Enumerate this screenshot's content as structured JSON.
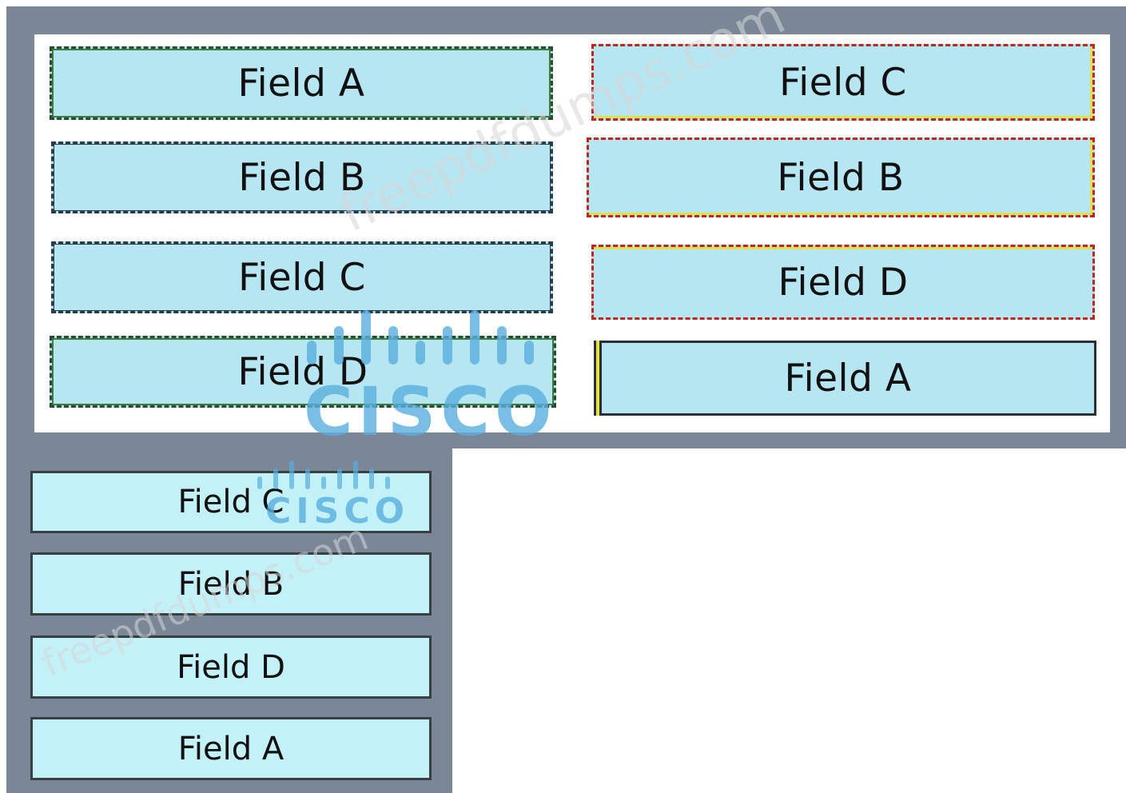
{
  "drop_targets_left": [
    {
      "label": "Field A"
    },
    {
      "label": "Field B"
    },
    {
      "label": "Field C"
    },
    {
      "label": "Field D"
    }
  ],
  "drop_targets_right": [
    {
      "label": "Field C"
    },
    {
      "label": "Field B"
    },
    {
      "label": "Field D"
    },
    {
      "label": "Field A"
    }
  ],
  "answer_list": [
    {
      "label": "Field C"
    },
    {
      "label": "Field B"
    },
    {
      "label": "Field D"
    },
    {
      "label": "Field A"
    }
  ],
  "watermark": {
    "site": "freepdfdumps.com",
    "logo_word": "CISCO"
  },
  "colors": {
    "frame": "#7a8797",
    "field_fill": "#b7e6f3",
    "answer_fill": "#c3f1f8",
    "green_dash": "#3e7c3d",
    "red_dash": "#c0251e",
    "yellow_accent": "#e4e04a",
    "logo_blue": "#5aaedf"
  }
}
